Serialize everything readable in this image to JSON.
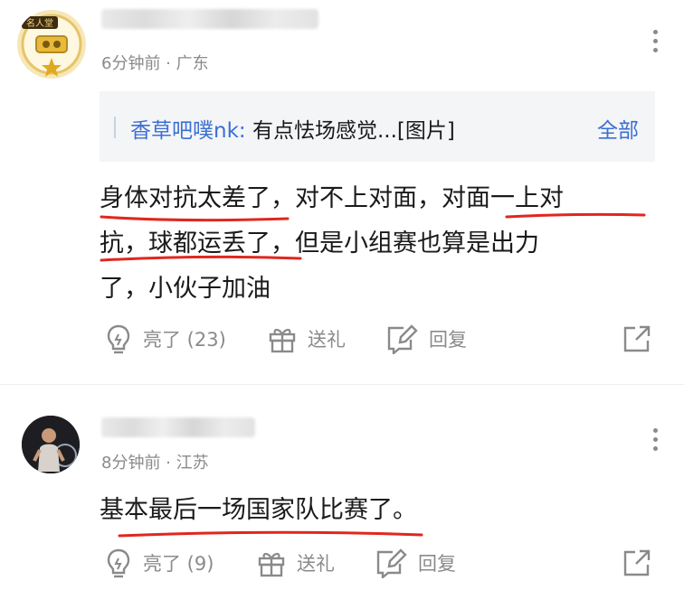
{
  "comments": [
    {
      "meta": "6分钟前 · 广东",
      "badge_text": "名人堂",
      "quote": {
        "name": "香草吧噗nk:",
        "text": " 有点怯场感觉...[图片]",
        "all_label": "全部"
      },
      "body_lines": [
        "身体对抗太差了，对不上对面，对面一上对",
        "抗，球都运丢了，但是小组赛也算是出力",
        "了，小伙子加油"
      ],
      "actions": {
        "like": "亮了 (23)",
        "gift": "送礼",
        "reply": "回复"
      }
    },
    {
      "meta": "8分钟前 · 江苏",
      "body_lines": [
        "基本最后一场国家队比赛了。"
      ],
      "actions": {
        "like": "亮了 (9)",
        "gift": "送礼",
        "reply": "回复"
      }
    }
  ],
  "colors": {
    "accent_blue": "#3b6fd1",
    "meta_gray": "#8a8a8a",
    "annotation_red": "#e0271e"
  },
  "icons": [
    "more-icon",
    "bulb-icon",
    "gift-icon",
    "edit-reply-icon",
    "share-icon"
  ]
}
